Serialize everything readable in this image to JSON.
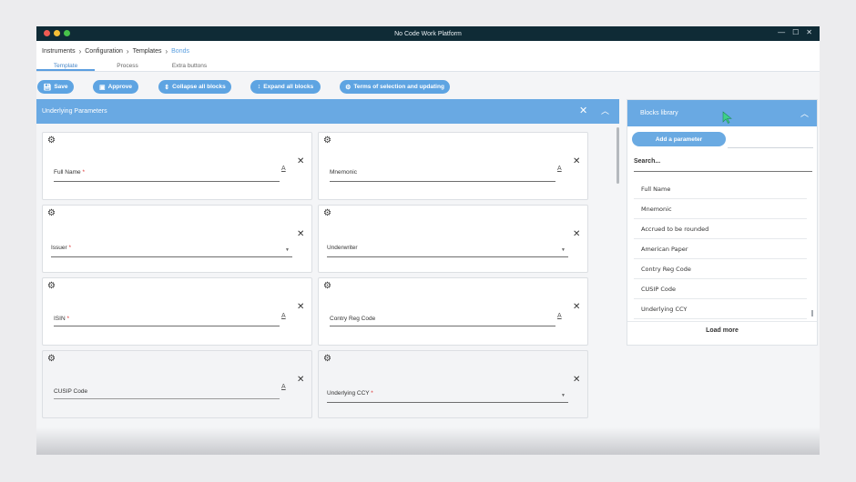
{
  "window": {
    "title": "No Code Work Platform",
    "dot_colors": [
      "#ef5b53",
      "#f5bf36",
      "#47c24a"
    ],
    "controls": [
      "—",
      "☐",
      "✕"
    ]
  },
  "breadcrumb": {
    "items": [
      "Instruments",
      "Configuration",
      "Templates"
    ],
    "current": "Bonds",
    "separator": "›"
  },
  "tabs": [
    {
      "label": "Template",
      "active": true
    },
    {
      "label": "Process",
      "active": false
    },
    {
      "label": "Extra buttons",
      "active": false
    }
  ],
  "toolbar": {
    "save": "Save",
    "approve": "Approve",
    "collapse": "Collapse all blocks",
    "expand": "Expand all blocks",
    "terms": "Terms of selection and updating"
  },
  "panel": {
    "title": "Underlying Parameters"
  },
  "cards": [
    {
      "label": "Full Name",
      "required": "*",
      "type": "text"
    },
    {
      "label": "Mnemonic",
      "required": "",
      "type": "text"
    },
    {
      "label": "Issuer",
      "required": "*",
      "type": "select"
    },
    {
      "label": "Underwriter",
      "required": "",
      "type": "select"
    },
    {
      "label": "ISIN",
      "required": "*",
      "type": "text"
    },
    {
      "label": "Contry Reg Code",
      "required": "",
      "type": "text"
    },
    {
      "label": "CUSIP Code",
      "required": "",
      "type": "text"
    },
    {
      "label": "Underlying CCY",
      "required": "*",
      "type": "select"
    }
  ],
  "library": {
    "title": "Blocks library",
    "add_button": "Add a parameter",
    "search_placeholder": "Search...",
    "items": [
      "Full Name",
      "Mnemonic",
      "Accrued to be rounded",
      "American Paper",
      "Contry Reg Code",
      "CUSIP Code",
      "Underlying CCY"
    ],
    "load_more": "Load more"
  },
  "icons": {
    "gear": "gear-icon",
    "close": "close-icon",
    "chevron_up": "chevron-up-icon",
    "text_format": "text-format-icon",
    "dropdown": "dropdown-caret-icon"
  },
  "colors": {
    "accent": "#5ea4e2",
    "header": "#69a9e3",
    "titlebar": "#0f2b36",
    "required": "#dd3333"
  }
}
